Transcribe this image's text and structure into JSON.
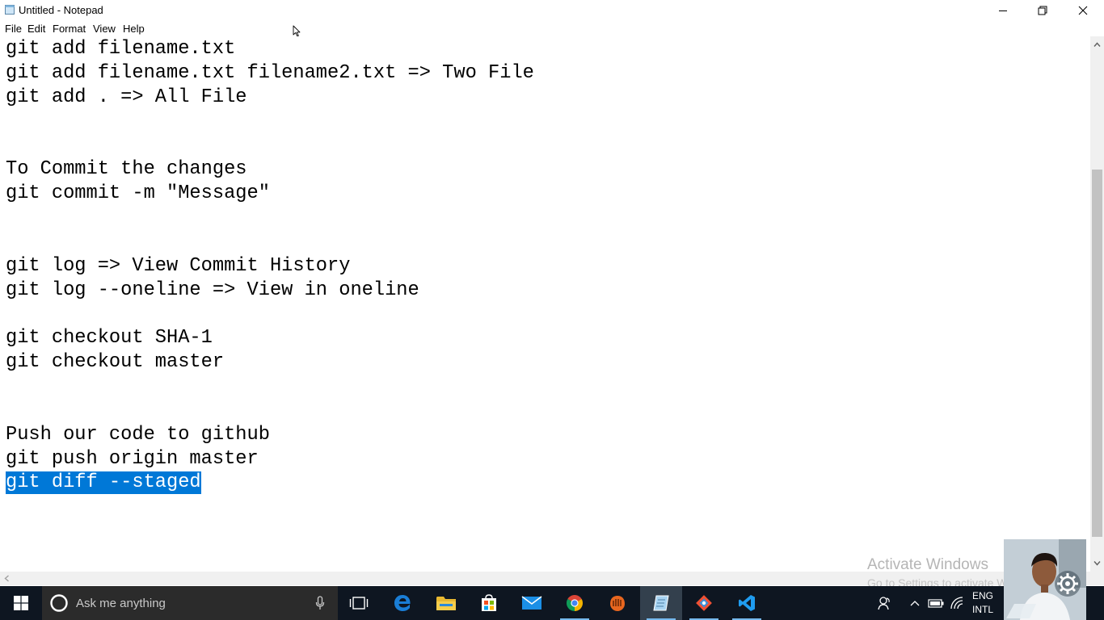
{
  "window": {
    "title": "Untitled - Notepad"
  },
  "menu": [
    "File",
    "Edit",
    "Format",
    "View",
    "Help"
  ],
  "editor": {
    "lines": [
      "git add filename.txt",
      "git add filename.txt filename2.txt => Two File",
      "git add . => All File",
      "",
      "",
      "To Commit the changes",
      "git commit -m \"Message\"",
      "",
      "",
      "git log => View Commit History",
      "git log --oneline => View in oneline",
      "",
      "git checkout SHA-1",
      "git checkout master",
      "",
      "",
      "Push our code to github",
      "git push origin master",
      "git diff --staged"
    ],
    "selected_line": "git diff --staged"
  },
  "watermark": {
    "line1": "Activate Windows",
    "line2": "Go to Settings to activate Windows."
  },
  "taskbar": {
    "search_placeholder": "Ask me anything",
    "apps": [
      "task-view",
      "edge",
      "file-explorer",
      "store",
      "mail",
      "chrome",
      "app-orange",
      "notepad",
      "git",
      "vscode"
    ],
    "language_line1": "ENG",
    "language_line2": "INTL"
  },
  "colors": {
    "selection": "#0078d7",
    "taskbar": "#0e1621",
    "watermark": "#b5b5b5"
  }
}
